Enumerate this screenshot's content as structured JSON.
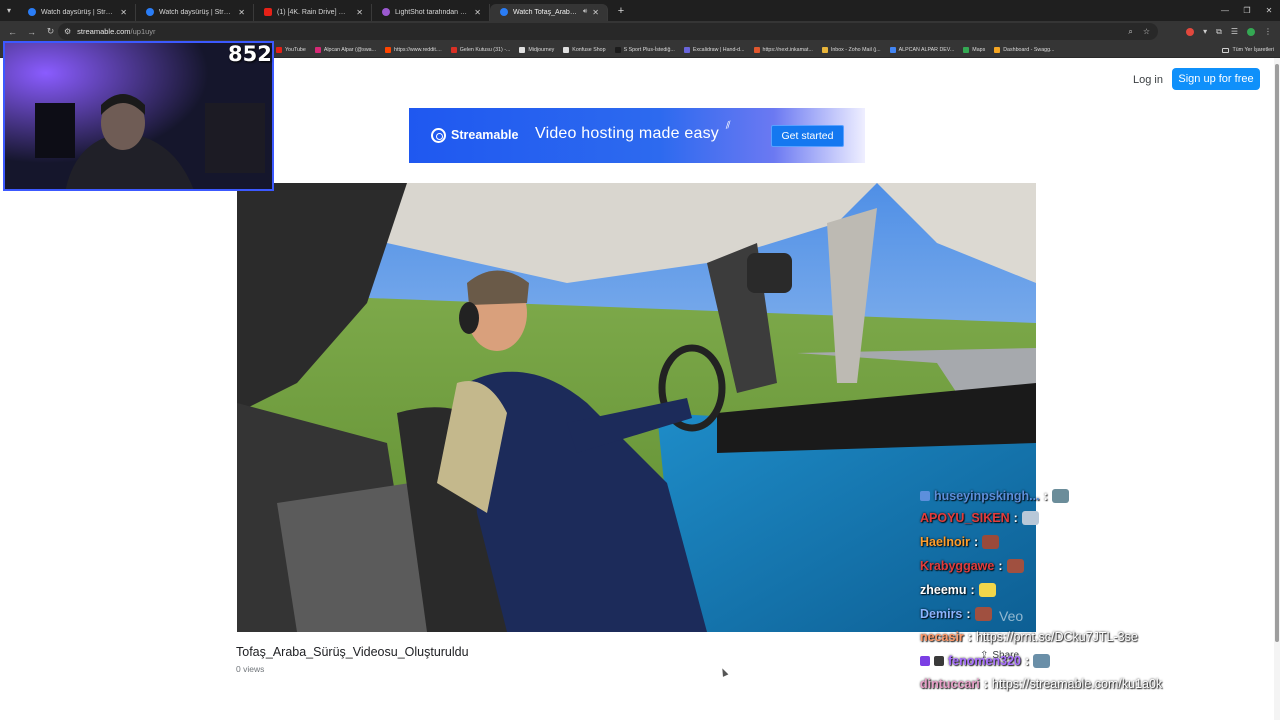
{
  "browser": {
    "tabs": [
      {
        "title": "Watch daysürüş | Streamable",
        "favicon_color": "#2a7df6",
        "active": false
      },
      {
        "title": "Watch daysürüş | Streamable",
        "favicon_color": "#2a7df6",
        "active": false
      },
      {
        "title": "(1) [4K. Rain Drive] 비를 맞으며",
        "favicon_color": "#e62117",
        "active": false
      },
      {
        "title": "LightShot tarafından Ekran Gö",
        "favicon_color": "#9b59d0",
        "active": false
      },
      {
        "title": "Watch Tofaş_Araba_Sürüş_V",
        "favicon_color": "#2a7df6",
        "active": true
      }
    ],
    "url_host": "streamable.com",
    "url_path": "/up1uyr",
    "bookmarks": [
      {
        "label": "YouTube",
        "color": "#e62117"
      },
      {
        "label": "Alpcan Alpar (@swa...",
        "color": "#d62976"
      },
      {
        "label": "https://www.reddit....",
        "color": "#ff4500"
      },
      {
        "label": "Gelen Kutusu (31) -...",
        "color": "#d93025"
      },
      {
        "label": "Midjourney",
        "color": "#e0e0e0"
      },
      {
        "label": "Konfuse Shop",
        "color": "#e0e0e0"
      },
      {
        "label": "S Sport Plus-İstediğ...",
        "color": "#1c1c1c"
      },
      {
        "label": "Excalidraw | Hand-d...",
        "color": "#6965db"
      },
      {
        "label": "https://next.inkamat...",
        "color": "#e0572e"
      },
      {
        "label": "Inbox - Zoho Mail (j...",
        "color": "#e8b43a"
      },
      {
        "label": "ALPCAN ALPAR DEV...",
        "color": "#4285f4"
      },
      {
        "label": "Maps",
        "color": "#34a853"
      },
      {
        "label": "Dashboard - Swagg...",
        "color": "#f5a623"
      }
    ],
    "all_bookmarks_label": "Tüm Yer İşaretleri"
  },
  "header": {
    "login_label": "Log in",
    "signup_label": "Sign up for free"
  },
  "banner": {
    "logo_text": "Streamable",
    "tagline": "Video hosting made easy",
    "cta_label": "Get started"
  },
  "video": {
    "title": "Tofaş_Araba_Sürüş_Videosu_Oluşturuldu",
    "views": "0 views",
    "watermark": "Veo",
    "share_label": "Share"
  },
  "stream": {
    "viewer_count": "852"
  },
  "chat": {
    "messages": [
      {
        "user": "huseyinpskingh...",
        "color": "#5c8fdc",
        "text": "",
        "emote_color": "#6b8d9a"
      },
      {
        "user": "APOYU_SIKEN",
        "color": "#e23c3c",
        "text": "",
        "emote_color": "#b8c8d8"
      },
      {
        "user": "Haelnoir",
        "color": "#ff9e2c",
        "text": "",
        "emote_color": "#9a4a3a"
      },
      {
        "user": "Krabyggawe",
        "color": "#e23c3c",
        "text": "",
        "emote_color": "#a05040"
      },
      {
        "user": "zheemu",
        "color": "#ffffff",
        "text": "",
        "emote_color": "#f2d64a"
      },
      {
        "user": "Demirs",
        "color": "#8bb4ff",
        "text": "",
        "emote_color": "#a05040"
      },
      {
        "user": "necasir",
        "color": "#ff9a6a",
        "text": "https://prnt.sc/DCku7JTL-3se",
        "emote_color": ""
      },
      {
        "user": "fenomen320",
        "color": "#a970ff",
        "text": "",
        "emote_color": "#6a8fa8"
      },
      {
        "user": "dintuccari",
        "color": "#e8a0c8",
        "text": "https://streamable.com/ku1a0k",
        "emote_color": ""
      }
    ]
  }
}
